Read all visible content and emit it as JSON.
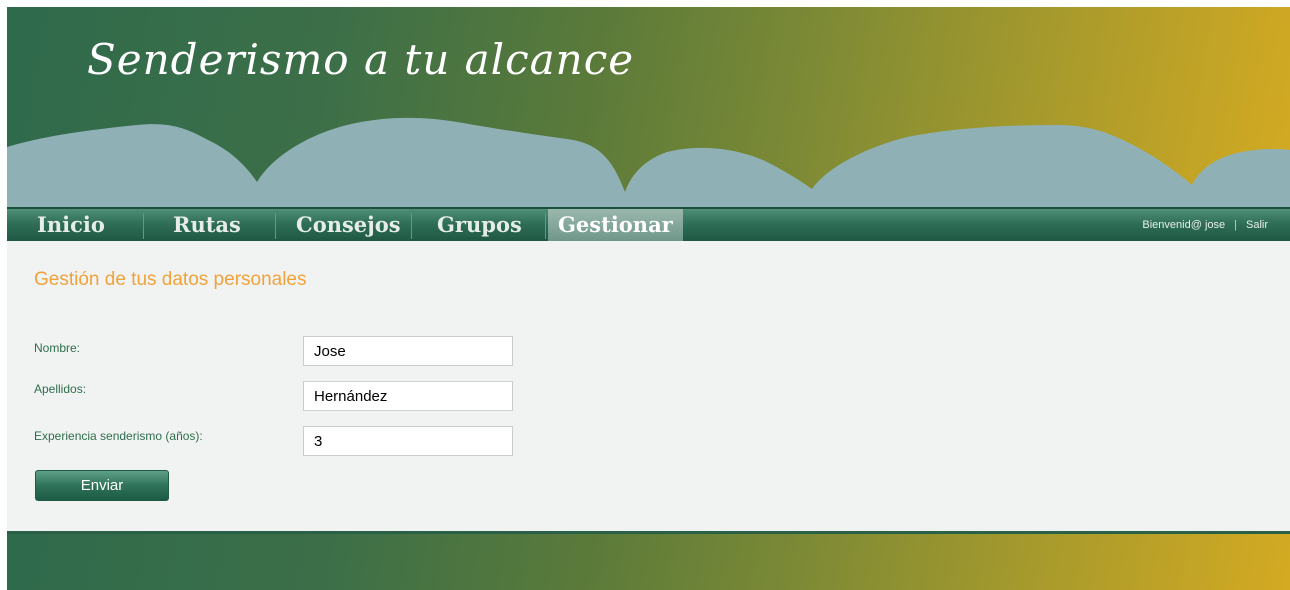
{
  "header": {
    "site_title": "Senderismo a tu alcance"
  },
  "nav": {
    "items": [
      {
        "label": "Inicio"
      },
      {
        "label": "Rutas"
      },
      {
        "label": "Consejos"
      },
      {
        "label": "Grupos"
      },
      {
        "label": "Gestionar",
        "active": true
      }
    ],
    "welcome": "Bienvenid@ jose",
    "separator": "|",
    "logout": "Salir"
  },
  "form": {
    "title": "Gestión de tus datos personales",
    "fields": [
      {
        "label": "Nombre:",
        "value": "Jose"
      },
      {
        "label": "Apellidos:",
        "value": "Hernández"
      },
      {
        "label": "Experiencia senderismo (años):",
        "value": "3"
      }
    ],
    "submit_label": "Enviar"
  },
  "colors": {
    "accent": "#f0a23b",
    "brand_green": "#2f6e57",
    "label_green": "#2e6e4c",
    "gold": "#d4aa22",
    "mountain": "#8fb1b6"
  }
}
